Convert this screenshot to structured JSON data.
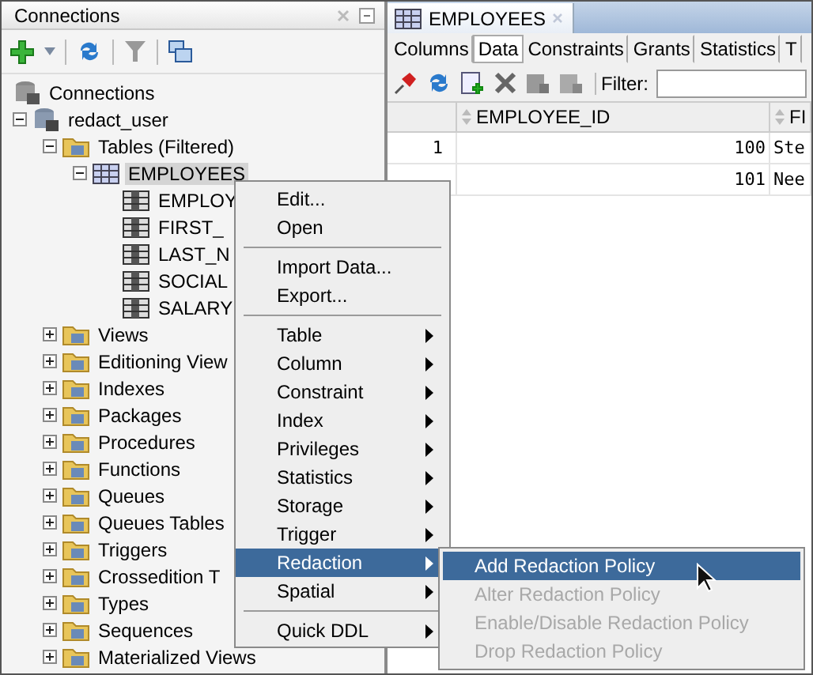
{
  "left_panel": {
    "title": "Connections",
    "tree": [
      {
        "label": "Connections",
        "kind": "connections",
        "selected": false,
        "children": [
          {
            "label": "redact_user",
            "kind": "database",
            "expanded": true,
            "selected": false,
            "children": [
              {
                "label": "Tables (Filtered)",
                "kind": "folder",
                "expanded": true,
                "selected": false,
                "children": [
                  {
                    "label": "EMPLOYEES",
                    "kind": "table",
                    "expanded": true,
                    "selected": true,
                    "children": [
                      {
                        "label": "EMPLOY",
                        "kind": "column",
                        "selected": false
                      },
                      {
                        "label": "FIRST_",
                        "kind": "column",
                        "selected": false
                      },
                      {
                        "label": "LAST_N",
                        "kind": "column",
                        "selected": false
                      },
                      {
                        "label": "SOCIAL",
                        "kind": "column",
                        "selected": false
                      },
                      {
                        "label": "SALARY",
                        "kind": "column",
                        "selected": false
                      }
                    ]
                  }
                ]
              },
              {
                "label": "Views",
                "kind": "folder",
                "expanded": false,
                "selected": false
              },
              {
                "label": "Editioning View",
                "kind": "folder",
                "expanded": false,
                "selected": false
              },
              {
                "label": "Indexes",
                "kind": "folder",
                "expanded": false,
                "selected": false
              },
              {
                "label": "Packages",
                "kind": "folder",
                "expanded": false,
                "selected": false
              },
              {
                "label": "Procedures",
                "kind": "folder",
                "expanded": false,
                "selected": false
              },
              {
                "label": "Functions",
                "kind": "folder",
                "expanded": false,
                "selected": false
              },
              {
                "label": "Queues",
                "kind": "folder",
                "expanded": false,
                "selected": false
              },
              {
                "label": "Queues Tables",
                "kind": "folder",
                "expanded": false,
                "selected": false
              },
              {
                "label": "Triggers",
                "kind": "folder",
                "expanded": false,
                "selected": false
              },
              {
                "label": "Crossedition T",
                "kind": "folder",
                "expanded": false,
                "selected": false
              },
              {
                "label": "Types",
                "kind": "folder",
                "expanded": false,
                "selected": false
              },
              {
                "label": "Sequences",
                "kind": "folder",
                "expanded": false,
                "selected": false
              },
              {
                "label": "Materialized Views",
                "kind": "folder",
                "expanded": false,
                "selected": false
              }
            ]
          }
        ]
      }
    ]
  },
  "editor": {
    "tab": {
      "label": "EMPLOYEES"
    },
    "subtabs": [
      {
        "label": "Columns",
        "selected": false
      },
      {
        "label": "Data",
        "selected": true
      },
      {
        "label": "Constraints",
        "selected": false
      },
      {
        "label": "Grants",
        "selected": false
      },
      {
        "label": "Statistics",
        "selected": false
      },
      {
        "label": "T",
        "selected": false
      }
    ],
    "filter": {
      "label": "Filter:"
    },
    "grid": {
      "columns": [
        "EMPLOYEE_ID",
        "FI"
      ],
      "rows": [
        {
          "number": "1",
          "cells": [
            "100",
            "Ste"
          ]
        },
        {
          "cells": [
            "101",
            "Nee"
          ]
        }
      ]
    }
  },
  "context_menu": {
    "items": [
      {
        "kind": "item",
        "label": "Edit...",
        "submenu": false,
        "selected": false
      },
      {
        "kind": "item",
        "label": "Open",
        "submenu": false,
        "selected": false
      },
      {
        "kind": "separator"
      },
      {
        "kind": "item",
        "label": "Import Data...",
        "submenu": false,
        "selected": false
      },
      {
        "kind": "item",
        "label": "Export...",
        "submenu": false,
        "selected": false
      },
      {
        "kind": "separator"
      },
      {
        "kind": "item",
        "label": "Table",
        "submenu": true,
        "selected": false
      },
      {
        "kind": "item",
        "label": "Column",
        "submenu": true,
        "selected": false
      },
      {
        "kind": "item",
        "label": "Constraint",
        "submenu": true,
        "selected": false
      },
      {
        "kind": "item",
        "label": "Index",
        "submenu": true,
        "selected": false
      },
      {
        "kind": "item",
        "label": "Privileges",
        "submenu": true,
        "selected": false
      },
      {
        "kind": "item",
        "label": "Statistics",
        "submenu": true,
        "selected": false
      },
      {
        "kind": "item",
        "label": "Storage",
        "submenu": true,
        "selected": false
      },
      {
        "kind": "item",
        "label": "Trigger",
        "submenu": true,
        "selected": false
      },
      {
        "kind": "item",
        "label": "Redaction",
        "submenu": true,
        "selected": true
      },
      {
        "kind": "item",
        "label": "Spatial",
        "submenu": true,
        "selected": false
      },
      {
        "kind": "separator"
      },
      {
        "kind": "item",
        "label": "Quick DDL",
        "submenu": true,
        "selected": false
      }
    ]
  },
  "submenu": {
    "items": [
      {
        "label": "Add Redaction Policy",
        "selected": true,
        "disabled": false
      },
      {
        "label": "Alter Redaction Policy",
        "selected": false,
        "disabled": true
      },
      {
        "label": "Enable/Disable Redaction Policy",
        "selected": false,
        "disabled": true
      },
      {
        "label": "Drop Redaction Policy",
        "selected": false,
        "disabled": true
      }
    ]
  }
}
